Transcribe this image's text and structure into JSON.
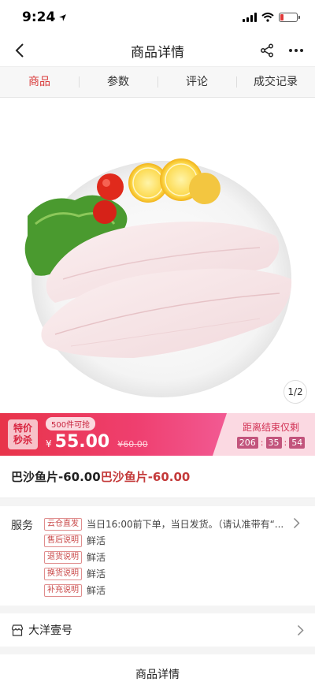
{
  "status_bar": {
    "time": "9:24"
  },
  "header": {
    "title": "商品详情"
  },
  "tabs": [
    {
      "label": "商品",
      "active": true
    },
    {
      "label": "参数",
      "active": false
    },
    {
      "label": "评论",
      "active": false
    },
    {
      "label": "成交记录",
      "active": false
    }
  ],
  "gallery": {
    "pager": "1/2"
  },
  "flash_sale": {
    "badge_line1": "特价",
    "badge_line2": "秒杀",
    "limit": "500件可抢",
    "currency": "¥",
    "price": "55.00",
    "original_price": "¥60.00",
    "countdown_label": "距离结束仅剩",
    "countdown": [
      "206",
      "35",
      "54"
    ]
  },
  "product": {
    "name_part1": "巴沙鱼片-60.00",
    "name_part2": "巴沙鱼片-60.00"
  },
  "service": {
    "label": "服务",
    "rows": [
      {
        "tag": "云仓直发",
        "text": "当日16:00前下单，当日发货。（请认准带有“..."
      },
      {
        "tag": "售后说明",
        "text": "鲜活"
      },
      {
        "tag": "退货说明",
        "text": "鲜活"
      },
      {
        "tag": "换货说明",
        "text": "鲜活"
      },
      {
        "tag": "补充说明",
        "text": "鲜活"
      }
    ]
  },
  "shop": {
    "name": "大洋壹号"
  },
  "detail_bar": {
    "label": "商品详情"
  },
  "colors": {
    "accent": "#d93b3b",
    "flash_start": "#e8344a",
    "flash_end": "#f25a93"
  },
  "icons": [
    "location-arrow-icon",
    "signal-icon",
    "wifi-icon",
    "battery-icon",
    "back-icon",
    "share-icon",
    "more-icon",
    "chevron-right-icon",
    "shop-icon"
  ]
}
